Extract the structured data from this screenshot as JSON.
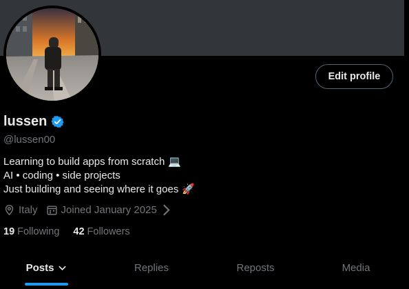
{
  "profile": {
    "display_name": "lussen",
    "handle": "@lussen00",
    "edit_button_label": "Edit profile",
    "verified": true,
    "accent_color": "#1d9bf0",
    "bio": [
      {
        "text": "Learning to build apps from scratch",
        "emoji": "💻"
      },
      {
        "text": "AI • coding • side projects",
        "emoji": ""
      },
      {
        "text": "Just building and seeing where it goes",
        "emoji": "🚀"
      }
    ],
    "location": "Italy",
    "joined": "Joined January 2025",
    "following_count": "19",
    "following_label": "Following",
    "followers_count": "42",
    "followers_label": "Followers"
  },
  "tabs": [
    {
      "label": "Posts",
      "active": true
    },
    {
      "label": "Replies",
      "active": false
    },
    {
      "label": "Reposts",
      "active": false
    },
    {
      "label": "Media",
      "active": false
    }
  ],
  "icons": {
    "verified": "verified-badge-icon",
    "location": "location-pin-icon",
    "calendar": "calendar-icon",
    "chevron": "chevron-right-icon",
    "caret": "chevron-down-icon"
  }
}
